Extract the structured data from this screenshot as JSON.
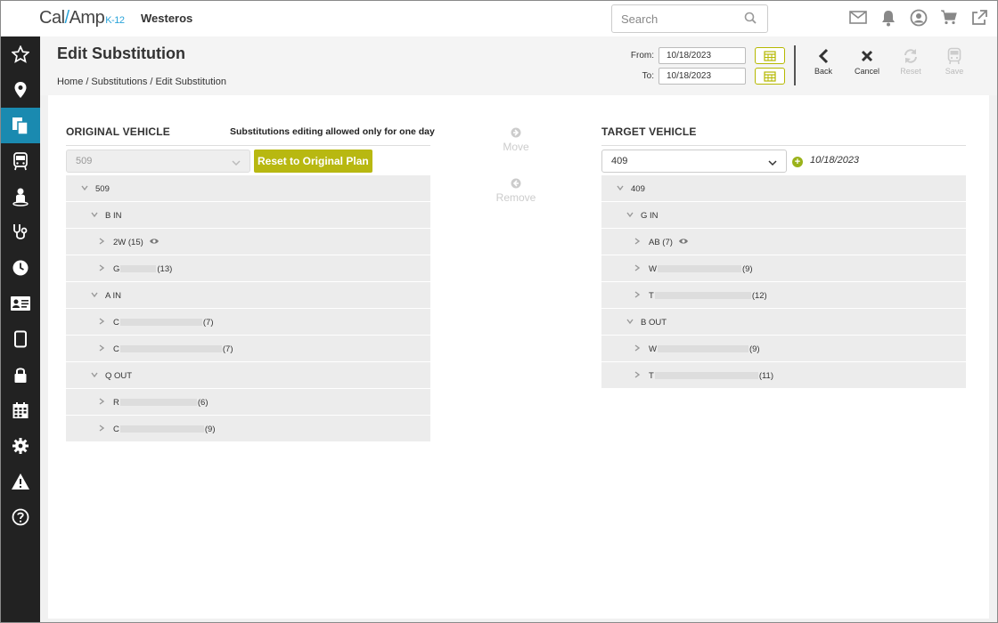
{
  "app": {
    "logo_text": "Cal",
    "logo_text2": "Amp",
    "logo_k12": "K-12",
    "org_name": "Westeros"
  },
  "search": {
    "placeholder": "Search"
  },
  "top_icons": [
    "mail-icon",
    "bell-icon",
    "user-icon",
    "cart-icon",
    "external-link-icon"
  ],
  "sidebar": {
    "items": [
      {
        "name": "star-icon",
        "active": false
      },
      {
        "name": "location-pin-icon",
        "active": false
      },
      {
        "name": "documents-icon",
        "active": true
      },
      {
        "name": "bus-icon",
        "active": false
      },
      {
        "name": "student-icon",
        "active": false
      },
      {
        "name": "stethoscope-icon",
        "active": false
      },
      {
        "name": "clock-icon",
        "active": false
      },
      {
        "name": "id-card-icon",
        "active": false
      },
      {
        "name": "tablet-icon",
        "active": false
      },
      {
        "name": "lock-icon",
        "active": false
      },
      {
        "name": "calendar-icon",
        "active": false
      },
      {
        "name": "gear-icon",
        "active": false
      },
      {
        "name": "warning-icon",
        "active": false
      },
      {
        "name": "help-icon",
        "active": false
      }
    ]
  },
  "header": {
    "title": "Edit Substitution",
    "breadcrumb": [
      "Home",
      "/",
      "Substitutions",
      "/",
      "Edit Substitution"
    ],
    "from_label": "From:",
    "from_value": "10/18/2023",
    "to_label": "To:",
    "to_value": "10/18/2023",
    "actions": {
      "back": "Back",
      "cancel": "Cancel",
      "reset": "Reset",
      "save": "Save"
    }
  },
  "original": {
    "title": "ORIGINAL VEHICLE",
    "note": "Substitutions editing allowed only for one day",
    "selected_vehicle": "509",
    "reset_button": "Reset to Original Plan",
    "tree": [
      {
        "level": 0,
        "label": "509"
      },
      {
        "level": 1,
        "label": "B IN"
      },
      {
        "level": 2,
        "label": "2W (15)",
        "eye": true
      },
      {
        "level": 2,
        "prefix": "G",
        "suffix": "(13)",
        "blur": 40
      },
      {
        "level": 1,
        "label": "A IN"
      },
      {
        "level": 2,
        "prefix": "C",
        "suffix": "(7)",
        "blur": 92
      },
      {
        "level": 2,
        "prefix": "C",
        "suffix": "(7)",
        "blur": 114
      },
      {
        "level": 1,
        "label": "Q OUT"
      },
      {
        "level": 2,
        "prefix": "R",
        "suffix": "(6)",
        "blur": 86
      },
      {
        "level": 2,
        "prefix": "C",
        "suffix": "(9)",
        "blur": 94
      }
    ]
  },
  "middle": {
    "move": "Move",
    "remove": "Remove"
  },
  "target": {
    "title": "TARGET VEHICLE",
    "selected_vehicle": "409",
    "date": "10/18/2023",
    "tree": [
      {
        "level": 0,
        "label": "409"
      },
      {
        "level": 1,
        "label": "G IN"
      },
      {
        "level": 2,
        "label": "AB (7)",
        "eye": true
      },
      {
        "level": 2,
        "prefix": "W",
        "suffix": "(9)",
        "blur": 94
      },
      {
        "level": 2,
        "prefix": "T",
        "suffix": "(12)",
        "blur": 108
      },
      {
        "level": 1,
        "label": "B OUT"
      },
      {
        "level": 2,
        "prefix": "W",
        "suffix": "(9)",
        "blur": 102
      },
      {
        "level": 2,
        "prefix": "T",
        "suffix": "(11)",
        "blur": 116
      }
    ]
  }
}
